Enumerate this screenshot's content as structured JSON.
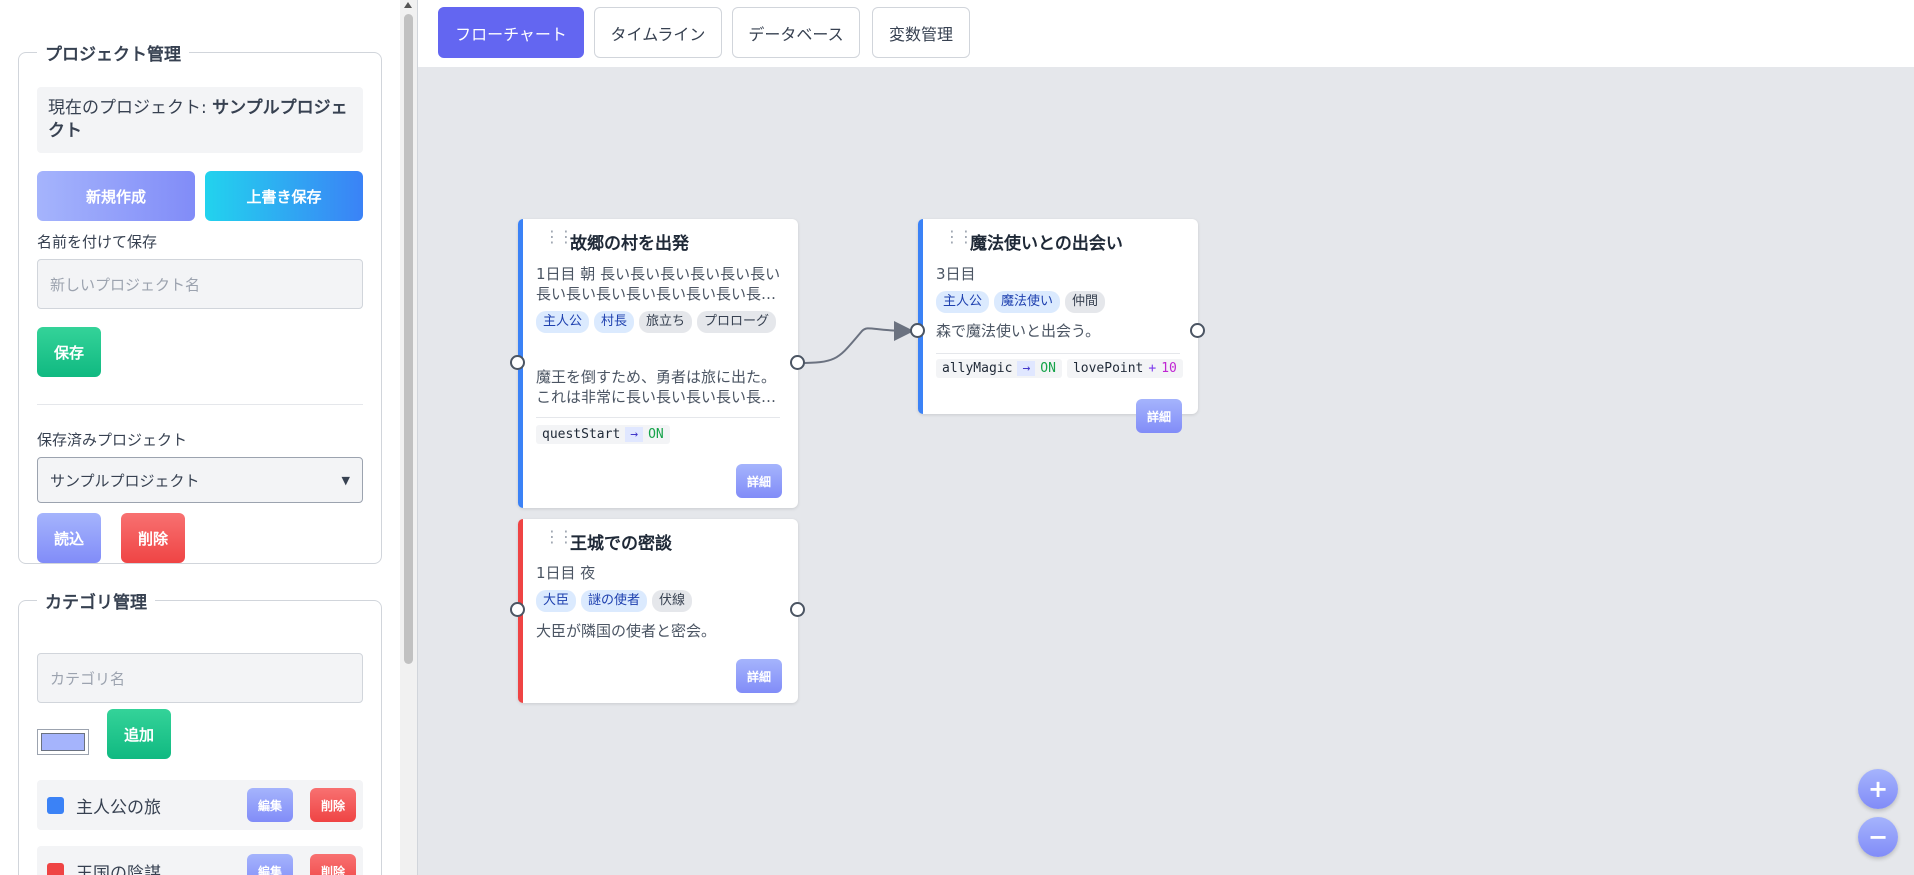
{
  "tabs": [
    "フローチャート",
    "タイムライン",
    "データベース",
    "変数管理"
  ],
  "project_panel": {
    "legend": "プロジェクト管理",
    "current_prefix": "現在のプロジェクト: ",
    "current_name": "サンプルプロジェクト",
    "new_label": "新規作成",
    "overwrite_label": "上書き保存",
    "save_as_label": "名前を付けて保存",
    "name_placeholder": "新しいプロジェクト名",
    "save_label": "保存",
    "saved_label": "保存済みプロジェクト",
    "selected_project": "サンプルプロジェクト",
    "load_label": "読込",
    "delete_label": "削除"
  },
  "category_panel": {
    "legend": "カテゴリ管理",
    "name_placeholder": "カテゴリ名",
    "add_label": "追加",
    "color_value": "#a5b4fc",
    "items": [
      {
        "name": "主人公の旅",
        "color": "#3b82f6",
        "edit": "編集",
        "delete": "削除"
      },
      {
        "name": "王国の陰謀",
        "color": "#ef4444",
        "edit": "編集",
        "delete": "削除"
      }
    ]
  },
  "nodes": [
    {
      "title": "故郷の村を出発",
      "time": "1日目 朝 長い長い長い長い長い長い長い長い長い長い長い長い長い長…",
      "tags": [
        {
          "t": "主人公",
          "k": "char"
        },
        {
          "t": "村長",
          "k": "char"
        },
        {
          "t": "旅立ち",
          "k": "misc"
        },
        {
          "t": "プロローグ",
          "k": "misc"
        }
      ],
      "desc": "魔王を倒すため、勇者は旅に出た。これは非常に長い長い長い長い長…",
      "vars": [
        {
          "name": "questStart",
          "op": "→",
          "val": "ON"
        }
      ],
      "detail": "詳細",
      "color": "#3b82f6"
    },
    {
      "title": "魔法使いとの出会い",
      "time": "3日目",
      "tags": [
        {
          "t": "主人公",
          "k": "char"
        },
        {
          "t": "魔法使い",
          "k": "char"
        },
        {
          "t": "仲間",
          "k": "misc"
        }
      ],
      "desc": "森で魔法使いと出会う。",
      "vars": [
        {
          "name": "allyMagic",
          "op": "→",
          "val": "ON"
        },
        {
          "name": "lovePoint",
          "op": "+",
          "val": "10"
        }
      ],
      "detail": "詳細",
      "color": "#3b82f6"
    },
    {
      "title": "王城での密談",
      "time": "1日目 夜",
      "tags": [
        {
          "t": "大臣",
          "k": "char"
        },
        {
          "t": "謎の使者",
          "k": "char"
        },
        {
          "t": "伏線",
          "k": "misc"
        }
      ],
      "desc": "大臣が隣国の使者と密会。",
      "vars": [],
      "detail": "詳細",
      "color": "#ef4444"
    }
  ],
  "zoom": {
    "in": "+",
    "out": "−"
  }
}
